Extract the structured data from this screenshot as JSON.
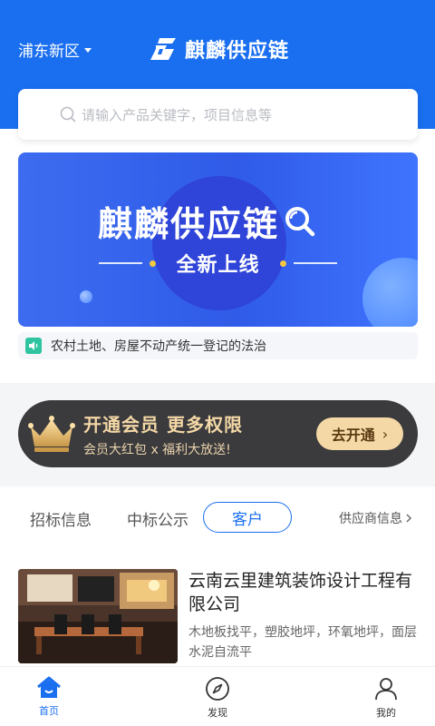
{
  "header": {
    "location": "浦东新区",
    "brand": "麒麟供应链"
  },
  "search": {
    "placeholder": "请输入产品关键字，项目信息等"
  },
  "banner": {
    "title": "麒麟供应链",
    "subtitle": "全新上线"
  },
  "notice": {
    "text": "农村土地、房屋不动产统一登记的法治"
  },
  "membership": {
    "title": "开通会员 更多权限",
    "subtitle": "会员大红包 x 福利大放送!",
    "button": "去开通",
    "chevron": "›"
  },
  "tabs": {
    "items": [
      {
        "label": "招标信息"
      },
      {
        "label": "中标公示"
      },
      {
        "label": "客户"
      }
    ],
    "active_index": 2,
    "more": "供应商信息"
  },
  "company": {
    "name": "云南云里建筑装饰设计工程有限公司",
    "description": "木地板找平，塑胶地坪，环氧地坪，面层水泥自流平"
  },
  "tabbar": {
    "items": [
      {
        "label": "首页",
        "icon": "home-icon"
      },
      {
        "label": "发现",
        "icon": "compass-icon"
      },
      {
        "label": "我的",
        "icon": "user-icon"
      }
    ],
    "active_index": 0
  },
  "colors": {
    "primary": "#1a6ff0",
    "member_bg": "#3b3a3c",
    "member_gold": "#f4d9a6",
    "notice_icon": "#2ec4a0"
  }
}
